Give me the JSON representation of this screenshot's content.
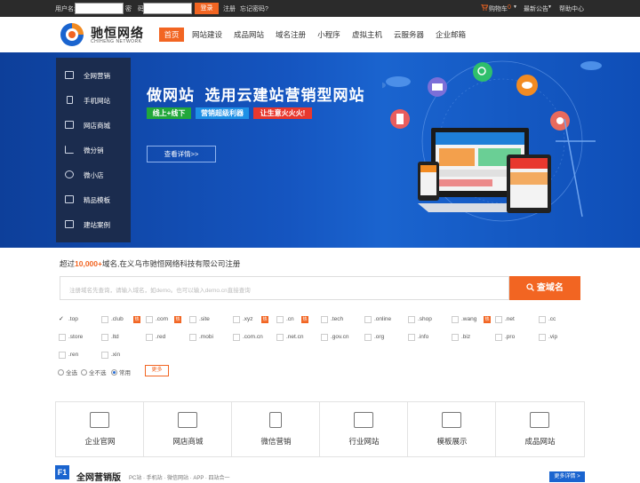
{
  "topbar": {
    "username_label": "用户名:",
    "password_label": "密　码:",
    "login_button": "登录",
    "register_link": "注册",
    "forgot_link": "忘记密码?",
    "cart_label": "购物车",
    "cart_count": "0",
    "news_label": "最新公告",
    "help_label": "帮助中心"
  },
  "header": {
    "logo_text": "驰恒网络",
    "logo_sub": "CHIHENG NETWORK",
    "nav": [
      "首页",
      "网站建设",
      "成品网站",
      "域名注册",
      "小程序",
      "虚拟主机",
      "云服务器",
      "企业邮箱"
    ]
  },
  "banner": {
    "side_menu": [
      "全网营销",
      "手机网站",
      "网店商城",
      "微分销",
      "微小店",
      "精品模板",
      "建站案例"
    ],
    "title_a": "做网站",
    "title_b": "选用云建站营销型网站",
    "tags": [
      "线上+线下",
      "营销超级利器",
      "让生意火火火!"
    ],
    "detail_button": "查看详情>>",
    "colors": {
      "tag1": "#21a73a",
      "tag2": "#1e90e6",
      "tag3": "#e8382e"
    }
  },
  "domain": {
    "slogan_pre": "超过",
    "slogan_count": "10,000+",
    "slogan_post": "域名,在义乌市驰恒网络科技有限公司注册",
    "search_placeholder": "注册域名先查询，请输入域名，如demo。也可以输入demo.cn直接查询",
    "search_button": "查域名",
    "row1": [
      ".top",
      ".club",
      ".com",
      ".site",
      ".xyz",
      ".cn",
      ".tech",
      ".online",
      ".shop",
      ".wang",
      ".net",
      ".cc"
    ],
    "row2": [
      ".store",
      ".ltd",
      ".red",
      ".mobi",
      ".com.cn",
      ".net.cn",
      ".gov.cn",
      ".org",
      ".info",
      ".biz",
      ".pro",
      ".vip"
    ],
    "row3": [
      ".ren",
      ".xin"
    ],
    "hot_badge": "热",
    "radio": [
      "全选",
      "全不选",
      "常用"
    ],
    "more_button": "更多"
  },
  "categories": [
    "企业官网",
    "网店商城",
    "微信营销",
    "行业网站",
    "模板展示",
    "成品网站"
  ],
  "section": {
    "badge": "F1",
    "title": "全网营销版",
    "subtitle": "PC站 · 手机站 · 微信网站 · APP · 四站合一",
    "more": "更多详情 >"
  }
}
